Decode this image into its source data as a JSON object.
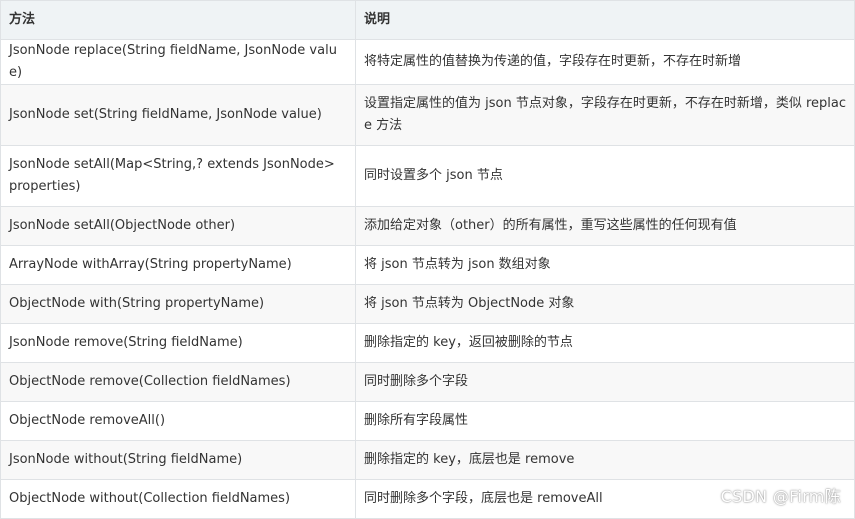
{
  "table": {
    "headers": [
      "方法",
      "说明"
    ],
    "rows": [
      {
        "method": "JsonNode replace(String fieldName, JsonNode value)",
        "desc": "将特定属性的值替换为传递的值，字段存在时更新，不存在时新增"
      },
      {
        "method": "JsonNode set(String fieldName, JsonNode value)",
        "desc": "设置指定属性的值为 json 节点对象，字段存在时更新，不存在时新增，类似 replace 方法"
      },
      {
        "method": "JsonNode setAll(Map<String,? extends JsonNode> properties)",
        "desc": "同时设置多个 json 节点"
      },
      {
        "method": "JsonNode setAll(ObjectNode other)",
        "desc": "添加给定对象（other）的所有属性，重写这些属性的任何现有值"
      },
      {
        "method": "ArrayNode withArray(String propertyName)",
        "desc": "将 json 节点转为 json 数组对象"
      },
      {
        "method": "ObjectNode with(String propertyName)",
        "desc": "将 json 节点转为 ObjectNode 对象"
      },
      {
        "method": "JsonNode remove(String fieldName)",
        "desc": "删除指定的 key，返回被删除的节点"
      },
      {
        "method": "ObjectNode remove(Collection fieldNames)",
        "desc": "同时删除多个字段"
      },
      {
        "method": "ObjectNode removeAll()",
        "desc": "删除所有字段属性"
      },
      {
        "method": "JsonNode without(String fieldName)",
        "desc": "删除指定的 key，底层也是 remove"
      },
      {
        "method": "ObjectNode without(Collection fieldNames)",
        "desc": "同时删除多个字段，底层也是 removeAll"
      }
    ]
  },
  "watermark": "CSDN @Firm陈",
  "colors": {
    "header_bg": "#eff3f5",
    "border": "#dfe2e5",
    "stripe": "#f8f8f8",
    "text": "#333333"
  }
}
